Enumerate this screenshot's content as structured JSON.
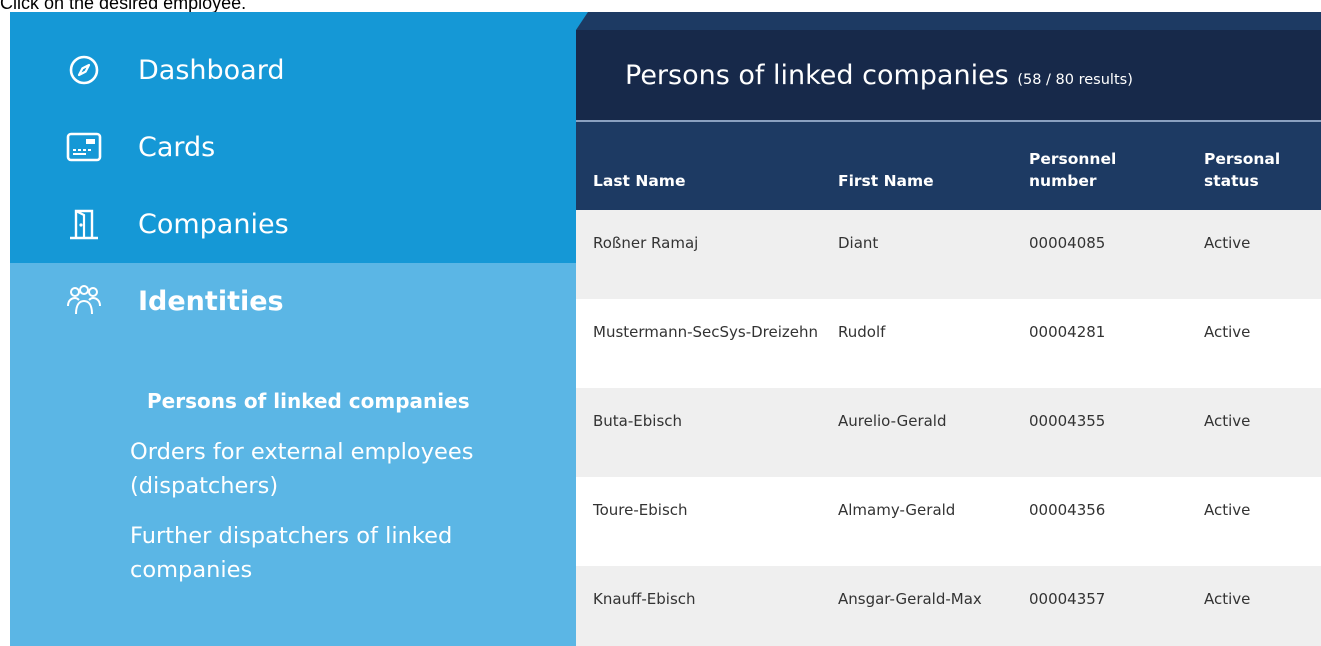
{
  "instruction": "Click on the desired employee.",
  "sidebar": {
    "items": [
      {
        "label": "Dashboard",
        "icon": "compass-icon"
      },
      {
        "label": "Cards",
        "icon": "card-icon"
      },
      {
        "label": "Companies",
        "icon": "door-icon"
      },
      {
        "label": "Identities",
        "icon": "people-icon"
      }
    ],
    "subitems": [
      {
        "label": "Persons of linked companies",
        "active": true
      },
      {
        "label": "Orders for external employees (dispatchers)"
      },
      {
        "label": "Further dispatchers of linked companies"
      }
    ]
  },
  "main": {
    "title": "Persons of linked companies",
    "result_count": "(58 / 80 results)",
    "table": {
      "columns": [
        "Last Name",
        "First Name",
        "Personnel number",
        "Personal status"
      ],
      "rows": [
        [
          "Roßner Ramaj",
          "Diant",
          "00004085",
          "Active"
        ],
        [
          "Mustermann-SecSys-Dreizehn",
          "Rudolf",
          "00004281",
          "Active"
        ],
        [
          "Buta-Ebisch",
          "Aurelio-Gerald",
          "00004355",
          "Active"
        ],
        [
          "Toure-Ebisch",
          "Almamy-Gerald",
          "00004356",
          "Active"
        ],
        [
          "Knauff-Ebisch",
          "Ansgar-Gerald-Max",
          "00004357",
          "Active"
        ]
      ]
    }
  },
  "colors": {
    "sidebar_dark": "#1598d6",
    "sidebar_light": "#5bb6e5",
    "header_navy": "#17294a",
    "table_header": "#1d3a63"
  }
}
